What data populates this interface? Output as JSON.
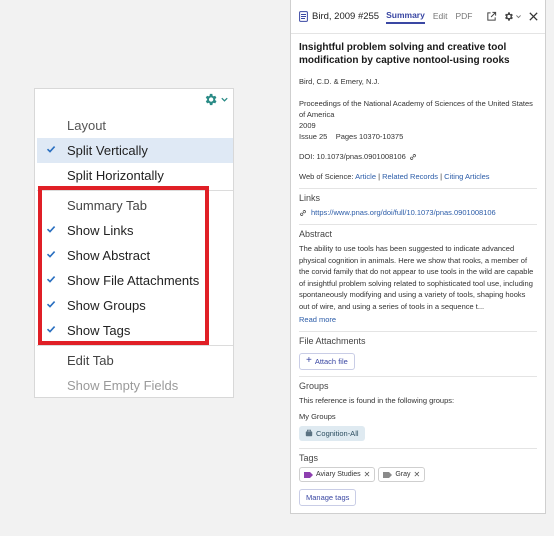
{
  "menu": {
    "items": [
      {
        "label": "Layout",
        "kind": "header",
        "checked": false
      },
      {
        "label": "Split Vertically",
        "kind": "option",
        "checked": true,
        "selected": true
      },
      {
        "label": "Split Horizontally",
        "kind": "option",
        "checked": false
      },
      {
        "label": "Summary Tab",
        "kind": "header",
        "checked": false
      },
      {
        "label": "Show Links",
        "kind": "option",
        "checked": true
      },
      {
        "label": "Show Abstract",
        "kind": "option",
        "checked": true
      },
      {
        "label": "Show File Attachments",
        "kind": "option",
        "checked": true
      },
      {
        "label": "Show Groups",
        "kind": "option",
        "checked": true
      },
      {
        "label": "Show Tags",
        "kind": "option",
        "checked": true
      },
      {
        "label": "Edit Tab",
        "kind": "header",
        "checked": false
      },
      {
        "label": "Show Empty Fields",
        "kind": "disabled",
        "checked": false
      }
    ]
  },
  "pane": {
    "ref_label": "Bird, 2009 #255",
    "tabs": [
      "Summary",
      "Edit",
      "PDF"
    ],
    "active_tab": "Summary",
    "title": "Insightful problem solving and creative tool modification by captive nontool-using rooks",
    "authors": "Bird, C.D. & Emery, N.J.",
    "journal": "Proceedings of the National Academy of Sciences of the United States of America",
    "year": "2009",
    "issue_label": "Issue 25",
    "pages_label": "Pages 10370-10375",
    "doi": "DOI: 10.1073/pnas.0901008106",
    "wos_label": "Web of Science:",
    "wos_links": [
      "Article",
      "Related Records",
      "Citing Articles"
    ],
    "links_title": "Links",
    "link_url": "https://www.pnas.org/doi/full/10.1073/pnas.0901008106",
    "abstract_title": "Abstract",
    "abstract_text": "The ability to use tools has been suggested to indicate advanced physical cognition in animals. Here we show that rooks, a member of the corvid family that do not appear to use tools in the wild are capable of insightful problem solving related to sophisticated tool use, including spontaneously modifying and using a variety of tools, shaping hooks out of wire, and using a series of tools in a sequence t...",
    "read_more": "Read more",
    "attachments_title": "File Attachments",
    "attach_button": "Attach file",
    "groups_title": "Groups",
    "groups_text": "This reference is found in the following groups:",
    "my_groups": "My Groups",
    "group_chip": "Cognition-All",
    "tags_title": "Tags",
    "tags": [
      {
        "label": "Aviary Studies",
        "color": "#8e3fb0"
      },
      {
        "label": "Gray",
        "color": "#8a8a8a"
      }
    ],
    "manage_tags": "Manage tags"
  },
  "colors": {
    "accent": "#3a47a3",
    "check": "#2a6fc0",
    "highlight": "#e01f26",
    "gear": "#2a8b86"
  }
}
